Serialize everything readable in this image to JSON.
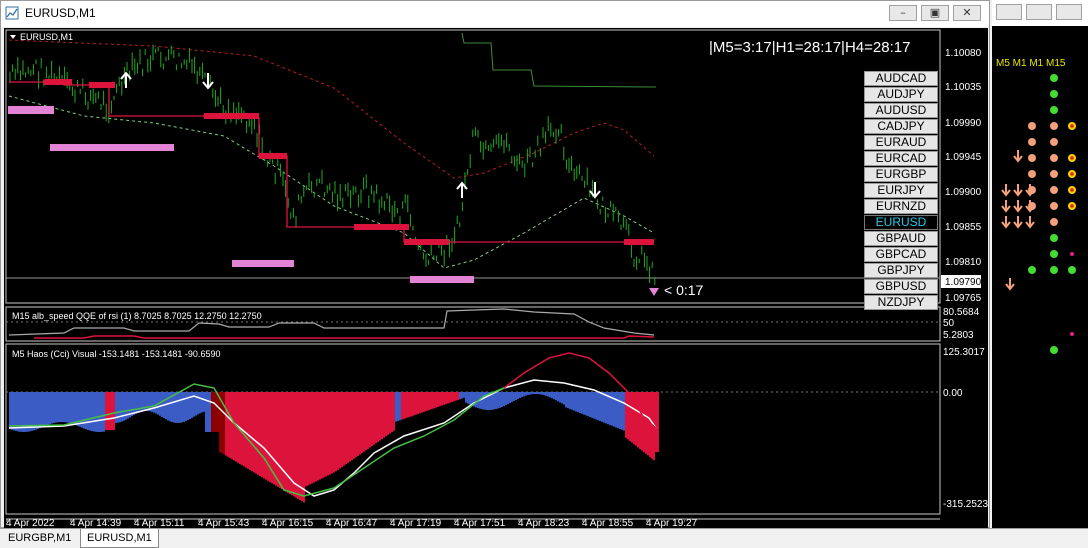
{
  "window": {
    "title": "EURUSD,M1"
  },
  "chart": {
    "label": "EURUSD,M1",
    "timer": "|M5=3:17|H1=28:17|H4=28:17",
    "countdown": "< 0:17",
    "current_price": "1.09790",
    "price_axis": [
      "1.10080",
      "1.10035",
      "1.09990",
      "1.09945",
      "1.09900",
      "1.09855",
      "1.09810",
      "1.09765"
    ],
    "colors": {
      "candles": "#22aa22",
      "accent": "#dc143c",
      "band": "#e383d6",
      "selected": "#29c8e8"
    }
  },
  "symbols": {
    "items": [
      "AUDCAD",
      "AUDJPY",
      "AUDUSD",
      "CADJPY",
      "EURAUD",
      "EURCAD",
      "EURGBP",
      "EURJPY",
      "EURNZD",
      "EURUSD",
      "GBPAUD",
      "GBPCAD",
      "GBPJPY",
      "GBPUSD",
      "NZDJPY"
    ],
    "selected": "EURUSD"
  },
  "indicator1": {
    "label": "M15 alb_speed QQE of rsi (1) 8.7025 8.7025 12.2750 12.2750",
    "axis": [
      "80.5684",
      "50",
      "5.2803"
    ]
  },
  "indicator2": {
    "label": "M5 Haos (Cci) Visual -153.1481 -153.1481 -90.6590",
    "axis": [
      "125.3017",
      "0.00",
      "-315.2523"
    ]
  },
  "time_axis": [
    "4 Apr 2022",
    "4 Apr 14:39",
    "4 Apr 15:11",
    "4 Apr 15:43",
    "4 Apr 16:15",
    "4 Apr 16:47",
    "4 Apr 17:19",
    "4 Apr 17:51",
    "4 Apr 18:23",
    "4 Apr 18:55",
    "4 Apr 19:27"
  ],
  "side_panel": {
    "header": "M5 M1 M1 M15"
  },
  "tabs": [
    {
      "label": "EURGBP,M1"
    },
    {
      "label": "EURUSD,M1"
    }
  ]
}
